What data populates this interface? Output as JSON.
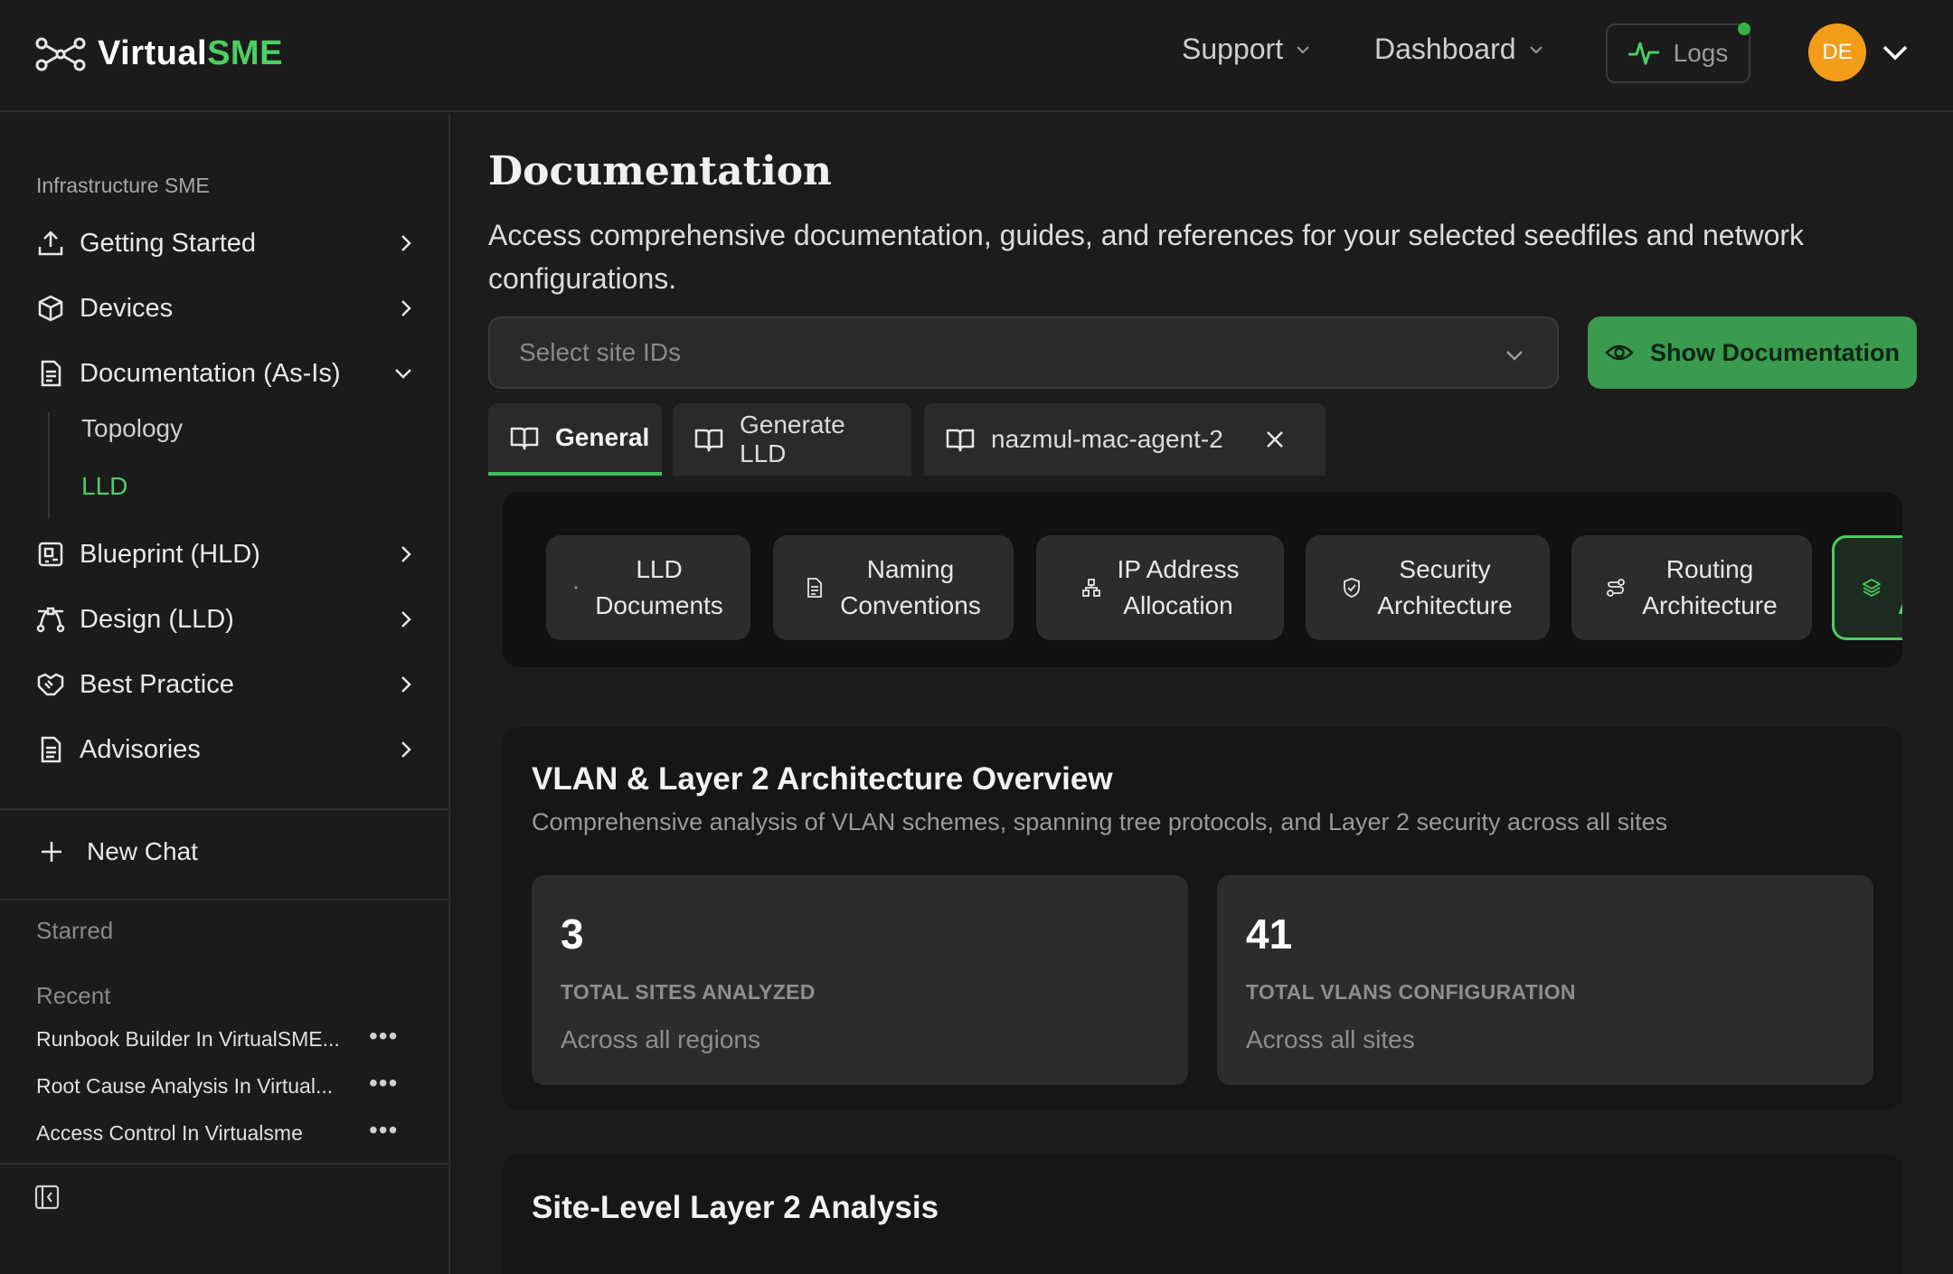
{
  "header": {
    "brand_prefix": "Virtual",
    "brand_suffix": "SME",
    "nav": [
      {
        "label": "Support"
      },
      {
        "label": "Dashboard"
      }
    ],
    "logs_label": "Logs",
    "avatar_initials": "DE"
  },
  "sidebar": {
    "section_title": "Infrastructure SME",
    "items": [
      {
        "label": "Getting Started",
        "icon": "upload-icon"
      },
      {
        "label": "Devices",
        "icon": "box-icon"
      },
      {
        "label": "Documentation (As-Is)",
        "icon": "file-text-icon",
        "expanded": true
      },
      {
        "label": "Blueprint (HLD)",
        "icon": "blueprint-icon"
      },
      {
        "label": "Design (LLD)",
        "icon": "bezier-icon"
      },
      {
        "label": "Best Practice",
        "icon": "handshake-icon"
      },
      {
        "label": "Advisories",
        "icon": "file-list-icon"
      }
    ],
    "sub_items": [
      {
        "label": "Topology"
      },
      {
        "label": "LLD",
        "active": true
      }
    ],
    "new_chat_label": "New Chat",
    "starred_label": "Starred",
    "recent_label": "Recent",
    "recent": [
      {
        "label": "Runbook Builder In VirtualSME..."
      },
      {
        "label": "Root Cause Analysis In Virtual..."
      },
      {
        "label": "Access Control In Virtualsme"
      }
    ]
  },
  "main": {
    "title": "Documentation",
    "description": "Access comprehensive documentation, guides, and references for your selected seedfiles and network configurations.",
    "site_select_placeholder": "Select site IDs",
    "show_button_label": "Show Documentation",
    "tabs": [
      {
        "label": "General",
        "active": true
      },
      {
        "label": "Generate LLD"
      },
      {
        "label": "nazmul-mac-agent-2",
        "closable": true
      }
    ],
    "categories": [
      {
        "line1": "LLD",
        "line2": "Documents",
        "icon": "dot-icon"
      },
      {
        "line1": "Naming",
        "line2": "Conventions",
        "icon": "document-icon"
      },
      {
        "line1": "IP Address",
        "line2": "Allocation",
        "icon": "network-icon"
      },
      {
        "line1": "Security",
        "line2": "Architecture",
        "icon": "shield-icon"
      },
      {
        "line1": "Routing",
        "line2": "Architecture",
        "icon": "route-icon"
      },
      {
        "line1": "Ar",
        "line2": "",
        "icon": "layers-icon",
        "active": true
      }
    ],
    "overview": {
      "title": "VLAN & Layer 2 Architecture Overview",
      "subtitle": "Comprehensive analysis of VLAN schemes, spanning tree protocols, and Layer 2 security across all sites",
      "stats": [
        {
          "value": "3",
          "label": "TOTAL SITES ANALYZED",
          "footnote": "Across all regions"
        },
        {
          "value": "41",
          "label": "TOTAL VLANS CONFIGURATION",
          "footnote": "Across all sites"
        }
      ]
    },
    "site_level_title": "Site-Level Layer 2 Analysis"
  },
  "colors": {
    "accent_green": "#4ccf62",
    "button_green": "#3a9a4f",
    "avatar_orange": "#f39c1a"
  }
}
